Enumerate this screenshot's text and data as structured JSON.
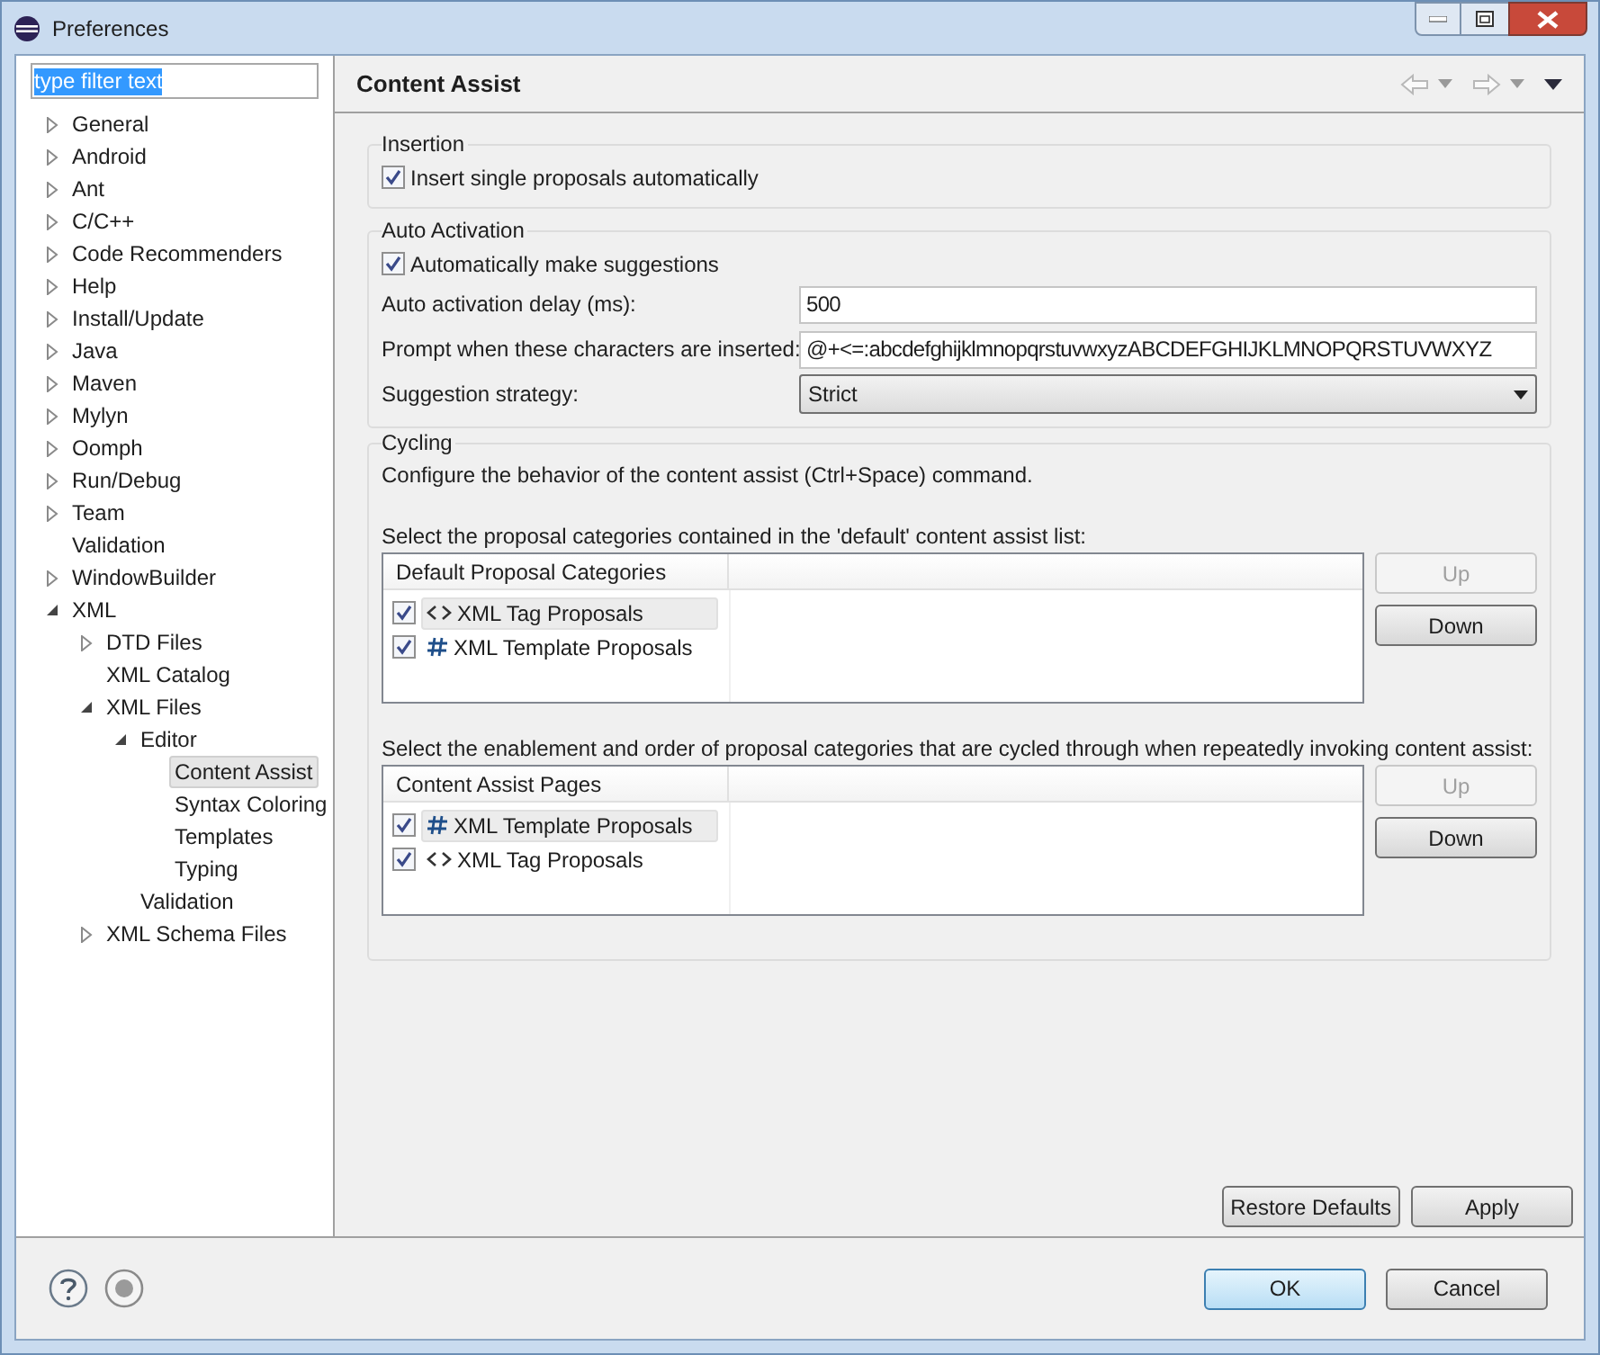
{
  "window": {
    "title": "Preferences"
  },
  "filter": {
    "value": "type filter text",
    "text_selected": true
  },
  "tree": [
    {
      "label": "General",
      "expanded": false,
      "selected": false
    },
    {
      "label": "Android",
      "expanded": false,
      "selected": false
    },
    {
      "label": "Ant",
      "expanded": false,
      "selected": false
    },
    {
      "label": "C/C++",
      "expanded": false,
      "selected": false
    },
    {
      "label": "Code Recommenders",
      "expanded": false,
      "selected": false
    },
    {
      "label": "Help",
      "expanded": false,
      "selected": false
    },
    {
      "label": "Install/Update",
      "expanded": false,
      "selected": false
    },
    {
      "label": "Java",
      "expanded": false,
      "selected": false
    },
    {
      "label": "Maven",
      "expanded": false,
      "selected": false
    },
    {
      "label": "Mylyn",
      "expanded": false,
      "selected": false
    },
    {
      "label": "Oomph",
      "expanded": false,
      "selected": false
    },
    {
      "label": "Run/Debug",
      "expanded": false,
      "selected": false
    },
    {
      "label": "Team",
      "expanded": false,
      "selected": false
    },
    {
      "label": "Validation",
      "selected": false
    },
    {
      "label": "WindowBuilder",
      "expanded": false,
      "selected": false
    },
    {
      "label": "XML",
      "expanded": true,
      "selected": false,
      "children": [
        {
          "label": "DTD Files",
          "expanded": false,
          "selected": false
        },
        {
          "label": "XML Catalog",
          "selected": false
        },
        {
          "label": "XML Files",
          "expanded": true,
          "selected": false,
          "children": [
            {
              "label": "Editor",
              "expanded": true,
              "selected": false,
              "children": [
                {
                  "label": "Content Assist",
                  "selected": true
                },
                {
                  "label": "Syntax Coloring",
                  "selected": false
                },
                {
                  "label": "Templates",
                  "selected": false
                },
                {
                  "label": "Typing",
                  "selected": false
                }
              ]
            },
            {
              "label": "Validation",
              "selected": false
            }
          ]
        },
        {
          "label": "XML Schema Files",
          "expanded": false,
          "selected": false
        }
      ]
    }
  ],
  "page": {
    "title": "Content Assist"
  },
  "insertion": {
    "title": "Insertion",
    "options": [
      {
        "label": "Insert single proposals automatically",
        "checked": true
      }
    ]
  },
  "auto_activation": {
    "title": "Auto Activation",
    "options": [
      {
        "label": "Automatically make suggestions",
        "checked": true
      }
    ],
    "fields": [
      {
        "kind": "text",
        "label": "Auto activation delay (ms):",
        "value": "500"
      },
      {
        "kind": "text",
        "label": "Prompt when these characters are inserted:",
        "value": "@+<=:abcdefghijklmnopqrstuvwxyzABCDEFGHIJKLMNOPQRSTUVWXYZ"
      },
      {
        "kind": "select",
        "label": "Suggestion strategy:",
        "value": "Strict"
      }
    ]
  },
  "cycling": {
    "title": "Cycling",
    "description": "Configure the behavior of the content assist (Ctrl+Space) command.",
    "lists": [
      {
        "caption": "Select the proposal categories contained in the 'default' content assist list:",
        "column": "Default Proposal Categories",
        "items": [
          {
            "kind": "tag",
            "label": "XML Tag Proposals",
            "checked": true,
            "selected": true
          },
          {
            "kind": "template",
            "label": "XML Template Proposals",
            "checked": true,
            "selected": false
          }
        ],
        "buttons": [
          {
            "label": "Up",
            "disabled": true
          },
          {
            "label": "Down",
            "disabled": false
          }
        ]
      },
      {
        "caption": "Select the enablement and order of proposal categories that are cycled through when repeatedly invoking content assist:",
        "column": "Content Assist Pages",
        "items": [
          {
            "kind": "template",
            "label": "XML Template Proposals",
            "checked": true,
            "selected": true
          },
          {
            "kind": "tag",
            "label": "XML Tag Proposals",
            "checked": true,
            "selected": false
          }
        ],
        "buttons": [
          {
            "label": "Up",
            "disabled": true
          },
          {
            "label": "Down",
            "disabled": false
          }
        ]
      }
    ]
  },
  "page_buttons": [
    "Restore Defaults",
    "Apply"
  ],
  "dialog_buttons": [
    {
      "label": "OK",
      "default": true
    },
    {
      "label": "Cancel",
      "default": false
    }
  ]
}
